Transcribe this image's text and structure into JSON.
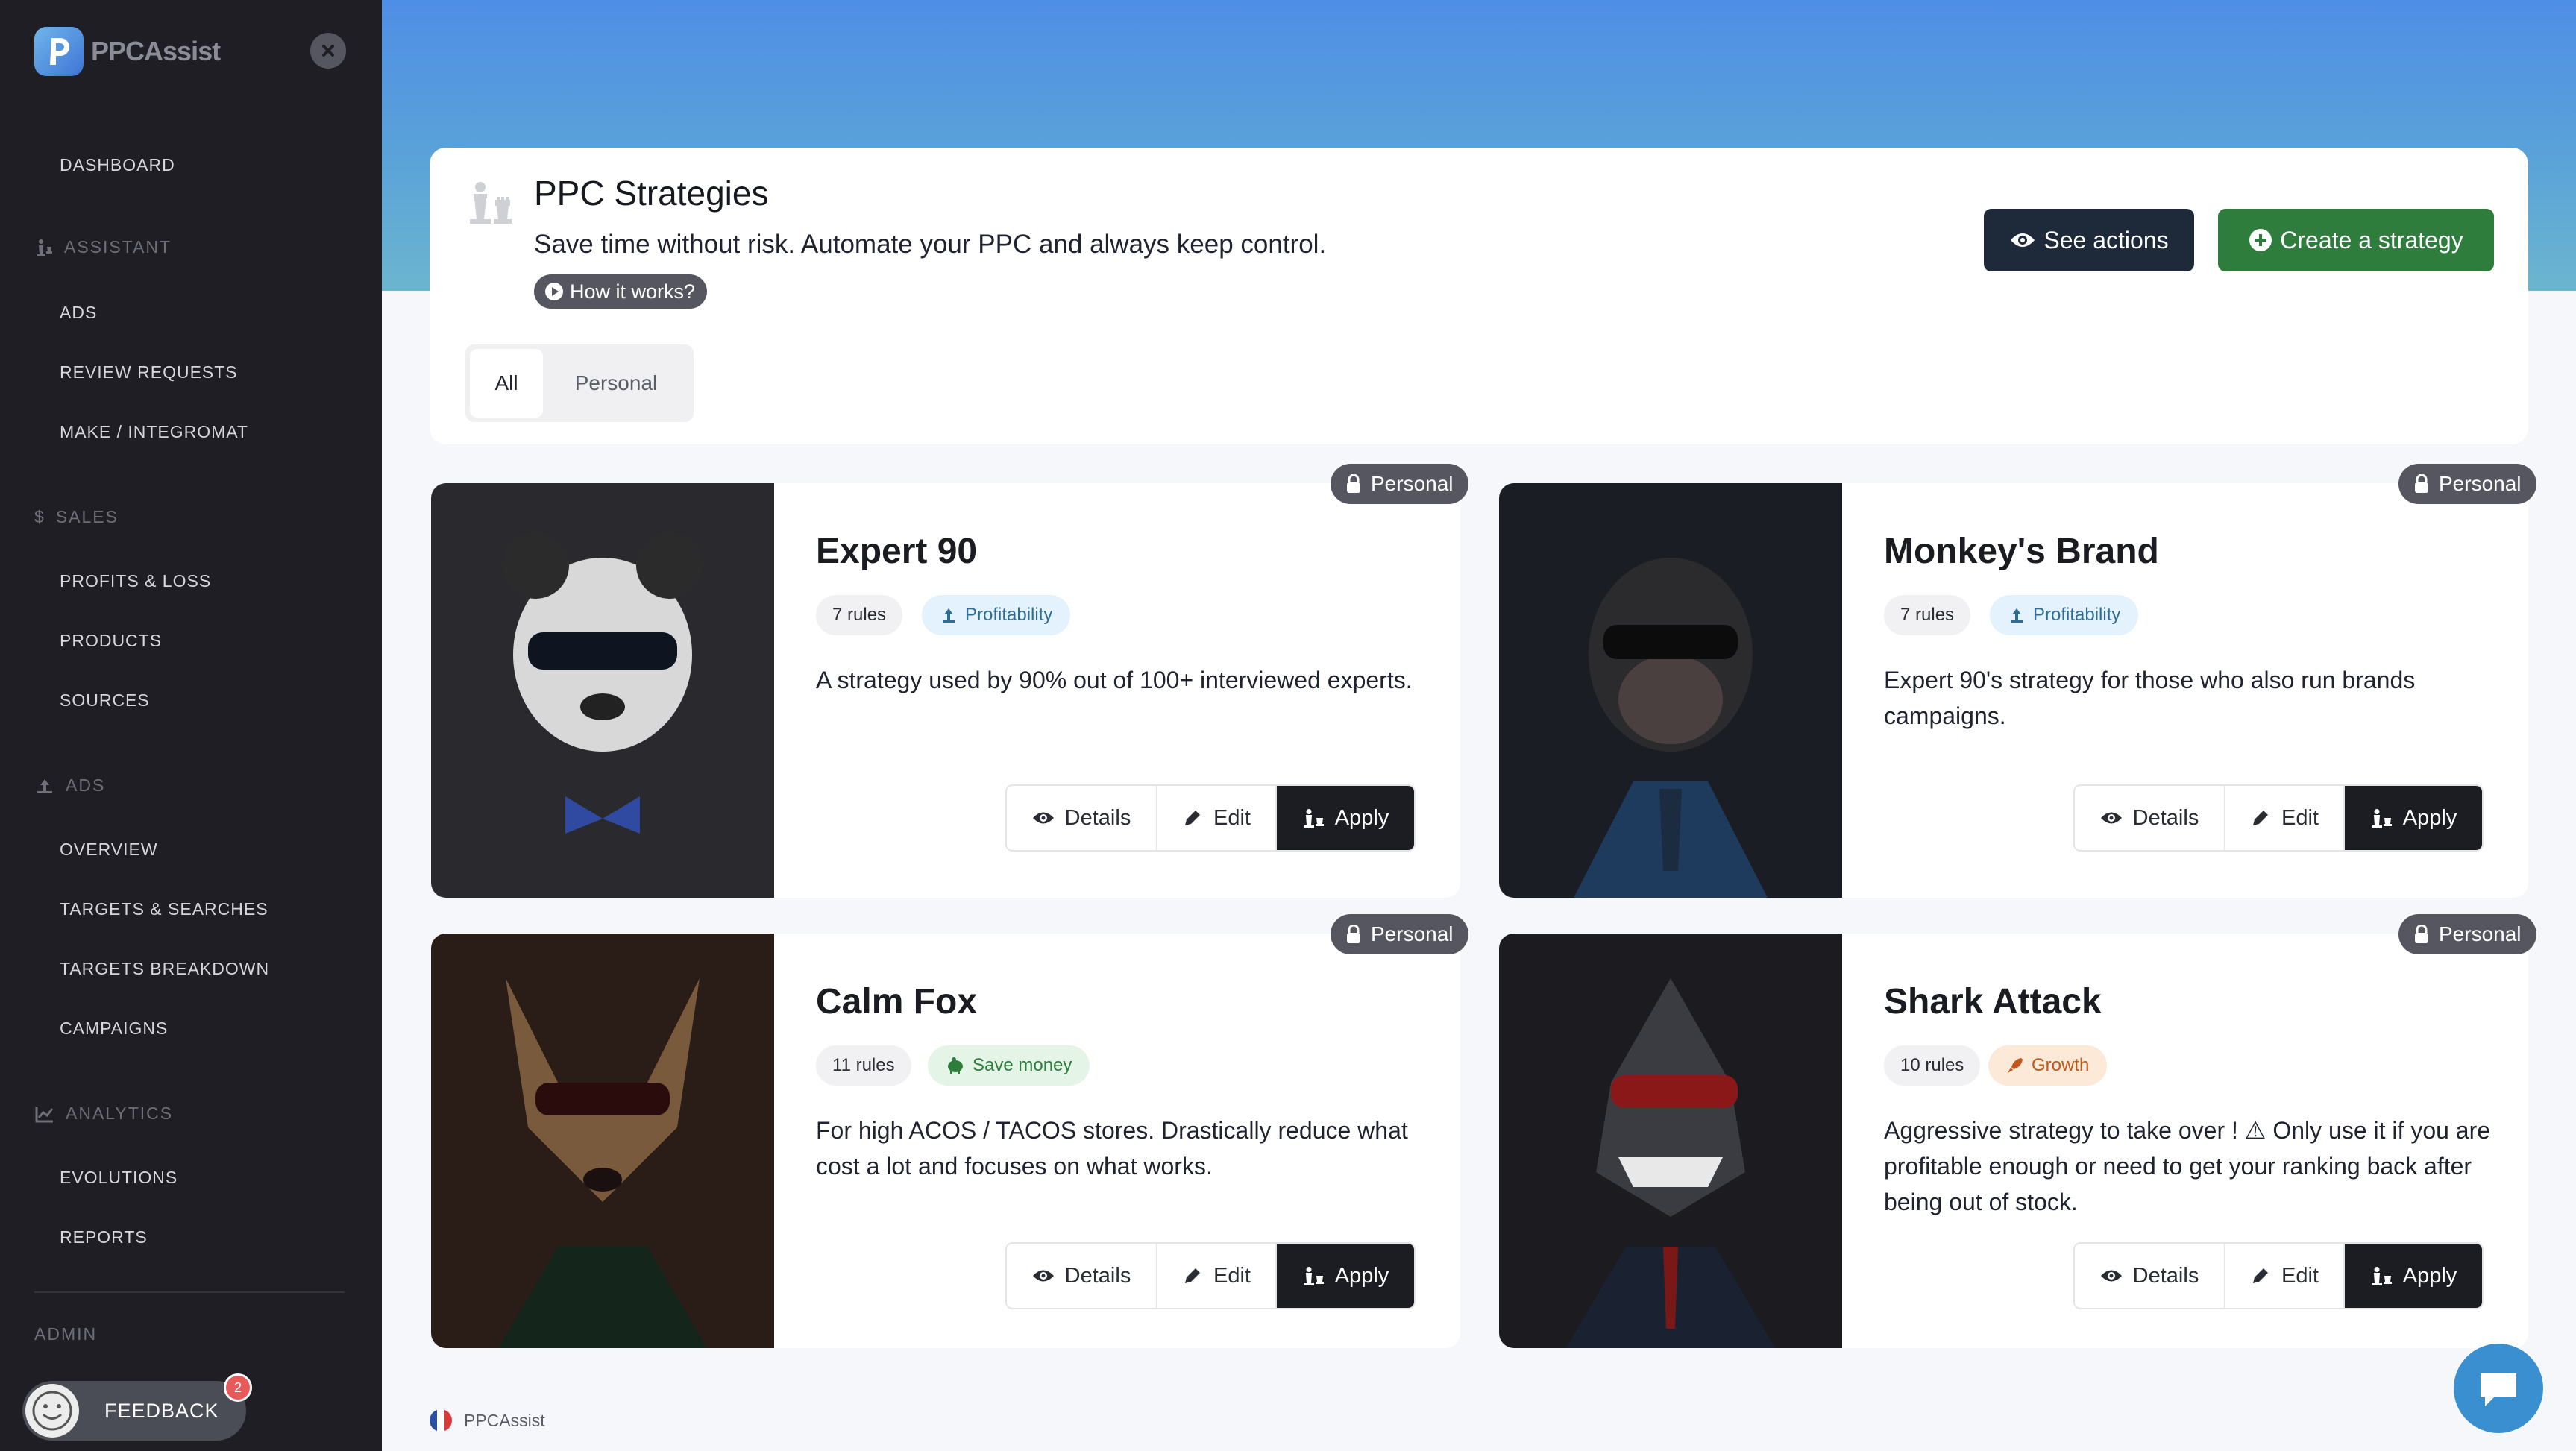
{
  "brand": {
    "name": "PPCAssist"
  },
  "sidebar": {
    "dashboard": "DASHBOARD",
    "sections": [
      {
        "label": "ASSISTANT",
        "icon": "chess-icon"
      },
      {
        "label": "SALES",
        "icon": "dollar-icon"
      },
      {
        "label": "ADS",
        "icon": "ads-icon"
      },
      {
        "label": "ANALYTICS",
        "icon": "chart-icon"
      },
      {
        "label": "ADMIN",
        "icon": ""
      }
    ],
    "items": {
      "ads": "ADS",
      "review_requests": "REVIEW REQUESTS",
      "make_integromat": "MAKE / INTEGROMAT",
      "profits_loss": "PROFITS & LOSS",
      "products": "PRODUCTS",
      "sources": "SOURCES",
      "overview": "OVERVIEW",
      "targets_searches": "TARGETS & SEARCHES",
      "targets_breakdown": "TARGETS BREAKDOWN",
      "campaigns": "CAMPAIGNS",
      "evolutions": "EVOLUTIONS",
      "reports": "REPORTS"
    },
    "feedback": {
      "label": "FEEDBACK",
      "badge": "2"
    }
  },
  "header": {
    "title": "PPC Strategies",
    "subtitle": "Save time without risk. Automate your PPC and always keep control.",
    "how_it_works": "How it works?",
    "see_actions": "See actions",
    "create_strategy": "Create a strategy",
    "tabs": [
      "All",
      "Personal"
    ]
  },
  "strategies": [
    {
      "title": "Expert 90",
      "rules": "7 rules",
      "tag": "Profitability",
      "tag_color": "#2f6d94",
      "description": "A strategy used by 90% out of 100+ interviewed experts.",
      "badge": "Personal",
      "image": "panda-portrait"
    },
    {
      "title": "Monkey's Brand",
      "rules": "7 rules",
      "tag": "Profitability",
      "tag_color": "#2f6d94",
      "description": "Expert 90's strategy for those who also run brands campaigns.",
      "badge": "Personal",
      "image": "monkey-portrait"
    },
    {
      "title": "Calm Fox",
      "rules": "11 rules",
      "tag": "Save money",
      "tag_color": "#2e7d3c",
      "description": "For high ACOS / TACOS stores. Drastically reduce what cost a lot and focuses on what works.",
      "badge": "Personal",
      "image": "fox-portrait"
    },
    {
      "title": "Shark Attack",
      "rules": "10 rules",
      "tag": "Growth",
      "tag_color": "#c2561b",
      "description": "Aggressive strategy to take over ! ⚠ Only use it if you are profitable enough or need to get your ranking back after being out of stock.",
      "badge": "Personal",
      "image": "shark-portrait"
    }
  ],
  "buttons": {
    "details": "Details",
    "edit": "Edit",
    "apply": "Apply"
  },
  "footer": {
    "label": "PPCAssist"
  },
  "colors": {
    "sidebar": "#1e1e24",
    "accent_blue": "#4f8ee6",
    "create_green": "#2e7d3c",
    "dark_button": "#1e2a3a"
  }
}
